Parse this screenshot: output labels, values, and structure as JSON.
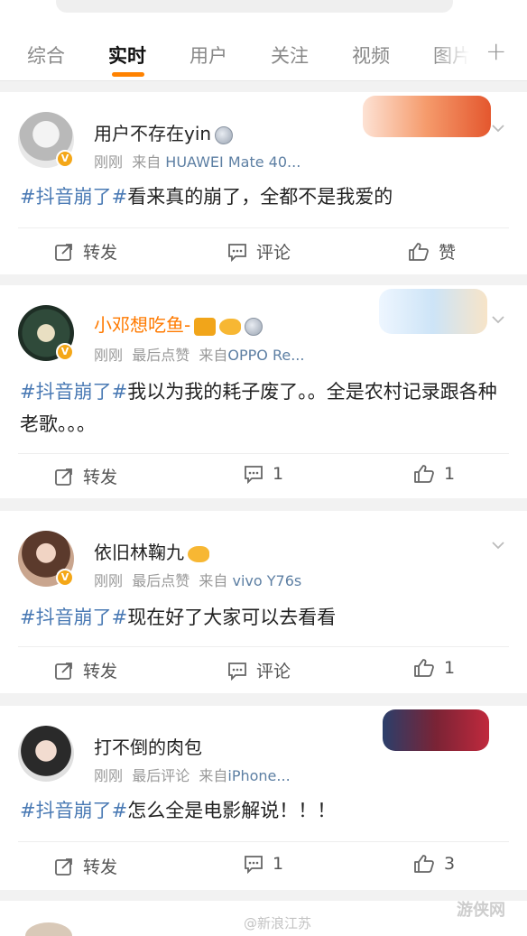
{
  "tabs": [
    "综合",
    "实时",
    "用户",
    "关注",
    "视频",
    "图片"
  ],
  "plus": "+",
  "posts": [
    {
      "username": "用户不存在yin",
      "meta_time": "刚刚",
      "meta_extra": "",
      "meta_from": "来自",
      "meta_source": "HUAWEI Mate 40...",
      "hashtag": "#抖音崩了#",
      "text": "看来真的崩了，全都不是我爱的",
      "repost": "转发",
      "comment": "评论",
      "like": "赞"
    },
    {
      "username": "小邓想吃鱼-",
      "meta_time": "刚刚",
      "meta_extra": "最后点赞",
      "meta_from": "来自",
      "meta_source": "OPPO Re...",
      "hashtag": "#抖音崩了#",
      "text": "我以为我的耗子废了。。全是农村记录跟各种老歌。。。",
      "repost": "转发",
      "comment": "1",
      "like": "1"
    },
    {
      "username": "依旧林鞠九",
      "meta_time": "刚刚",
      "meta_extra": "最后点赞",
      "meta_from": "来自",
      "meta_source": "vivo Y76s",
      "hashtag": "#抖音崩了#",
      "text": "现在好了大家可以去看看",
      "repost": "转发",
      "comment": "评论",
      "like": "1"
    },
    {
      "username": "打不倒的肉包",
      "meta_time": "刚刚",
      "meta_extra": "最后评论",
      "meta_from": "来自",
      "meta_source": "iPhone...",
      "hashtag": "#抖音崩了#",
      "text": "怎么全是电影解说！！！",
      "repost": "转发",
      "comment": "1",
      "like": "3"
    }
  ],
  "watermark": "@新浪江苏",
  "watermark_site": "游侠网",
  "colors": {
    "accent": "#ff8200",
    "hashtag": "#4a7ab4",
    "orange_name": "#ff7a00"
  }
}
